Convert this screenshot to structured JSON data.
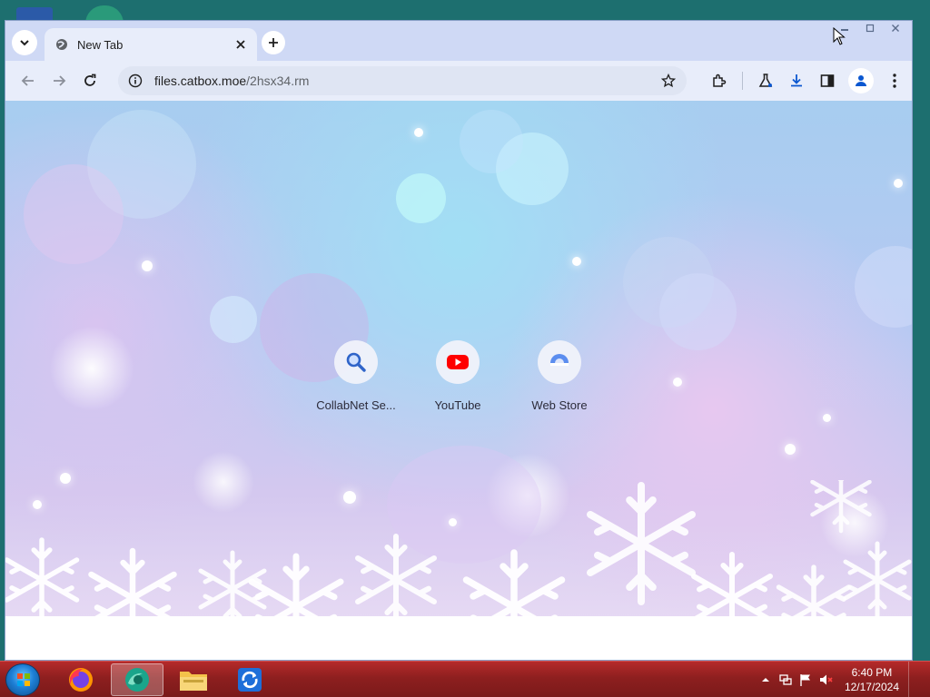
{
  "browser": {
    "tab": {
      "title": "New Tab"
    },
    "address": {
      "host": "files.catbox.moe",
      "path": "/2hsx34.rm"
    }
  },
  "ntp": {
    "shortcuts": [
      {
        "label": "CollabNet Se...",
        "icon": "search-icon"
      },
      {
        "label": "YouTube",
        "icon": "youtube-icon"
      },
      {
        "label": "Web Store",
        "icon": "web-store-icon"
      }
    ]
  },
  "taskbar": {
    "apps": [
      "firefox",
      "chrome-like-browser",
      "file-explorer",
      "sync-app"
    ],
    "clock": {
      "time": "6:40 PM",
      "date": "12/17/2024"
    }
  },
  "colors": {
    "accent": "#0b57d0",
    "youtube": "#ff0000",
    "taskbar": "#8e1f1f"
  }
}
